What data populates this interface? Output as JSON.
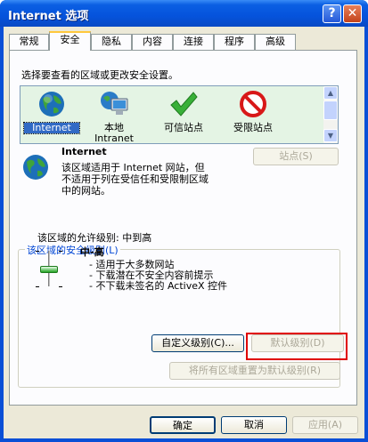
{
  "window": {
    "title": "Internet 选项"
  },
  "titlebar_buttons": {
    "help": "?",
    "close": "✕"
  },
  "tabs": [
    "常规",
    "安全",
    "隐私",
    "内容",
    "连接",
    "程序",
    "高级"
  ],
  "instruction": "选择要查看的区域或更改安全设置。",
  "zones": [
    {
      "label": "Internet",
      "icon": "globe-icon"
    },
    {
      "label": "本地\nIntranet",
      "icon": "intranet-computer-icon"
    },
    {
      "label": "可信站点",
      "icon": "green-checkmark-icon"
    },
    {
      "label": "受限站点",
      "icon": "restricted-sign-icon"
    }
  ],
  "zone_info": {
    "title": "Internet",
    "description_lines": [
      "该区域适用于 Internet 网站，但",
      "不适用于列在受信任和受限制区域",
      "中的网站。"
    ]
  },
  "sites_button": "站点(S)",
  "security_group": {
    "title": "该区域的安全级别(L)",
    "allowed_levels": "该区域的允许级别: 中到高",
    "level_name": "中-高",
    "bullets": [
      "- 适用于大多数网站",
      "- 下载潜在不安全内容前提示",
      "- 不下载未签名的 ActiveX 控件"
    ],
    "slider_level_fraction": 0.5
  },
  "buttons": {
    "custom_level": "自定义级别(C)...",
    "default_level": "默认级别(D)",
    "reset_all": "将所有区域重置为默认级别(R)",
    "ok": "确定",
    "cancel": "取消",
    "apply": "应用(A)"
  },
  "colors": {
    "titlebar": "#0553dc",
    "face": "#ece9d8",
    "zone_bg": "#e4f4e4",
    "highlight": "#e00000"
  }
}
